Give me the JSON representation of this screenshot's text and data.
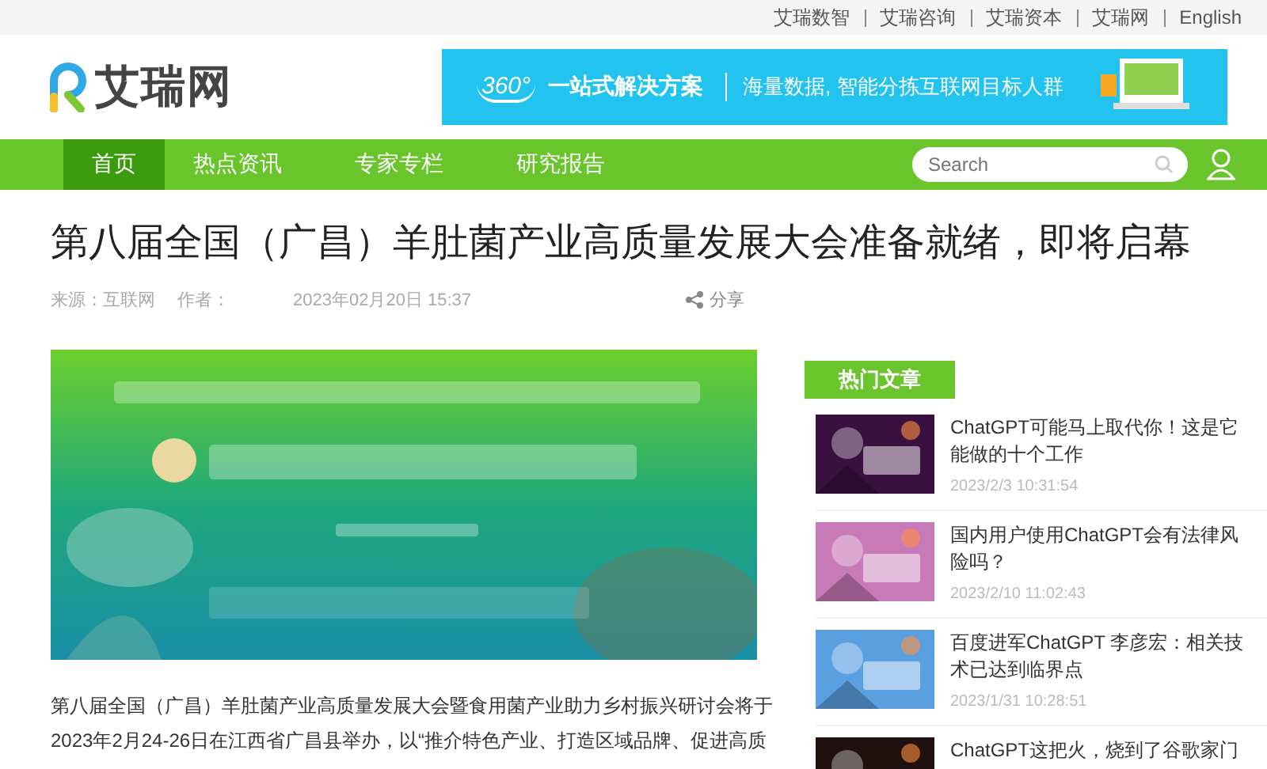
{
  "top_links": [
    "艾瑞数智",
    "艾瑞咨询",
    "艾瑞资本",
    "艾瑞网",
    "English"
  ],
  "logo": {
    "text": "艾瑞网"
  },
  "ad_banner": {
    "badge": "360°",
    "headline": "一站式解决方案",
    "tagline": "海量数据, 智能分拣互联网目标人群"
  },
  "nav": {
    "items": [
      {
        "label": "首页",
        "selected": true
      },
      {
        "label": "热点资讯",
        "selected": false
      },
      {
        "label": "专家专栏",
        "selected": false
      },
      {
        "label": "研究报告",
        "selected": false
      }
    ],
    "search": {
      "placeholder": "Search"
    }
  },
  "article": {
    "title": "第八届全国（广昌）羊肚菌产业高质量发展大会准备就绪，即将启幕",
    "source": "来源：互联网",
    "author": "作者：",
    "date": "2023年02月20日 15:37",
    "share": "分享",
    "body": "第八届全国（广昌）羊肚菌产业高质量发展大会暨食用菌产业助力乡村振兴研讨会将于\n2023年2月24-26日在江西省广昌县举办，以“推介特色产业、打造区域品牌、促进高质"
  },
  "sidebar": {
    "heading": "热门文章",
    "items": [
      {
        "title": "ChatGPT可能马上取代你！这是它能做的十个工作",
        "date": "2023/2/3 10:31:54"
      },
      {
        "title": "国内用户使用ChatGPT会有法律风险吗？",
        "date": "2023/2/10 11:02:43"
      },
      {
        "title": "百度进军ChatGPT 李彦宏：相关技术已达到临界点",
        "date": "2023/1/31 10:28:51"
      },
      {
        "title": "ChatGPT这把火，烧到了谷歌家门"
      }
    ]
  }
}
